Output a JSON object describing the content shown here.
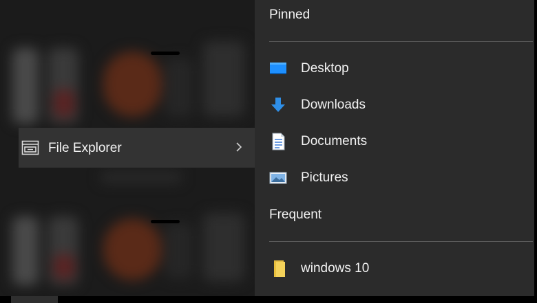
{
  "start_menu": {
    "app_item": {
      "label": "File Explorer",
      "icon": "file-explorer-icon",
      "chevron": "chevron-right-icon"
    }
  },
  "jump_list": {
    "pinned_header": "Pinned",
    "pinned_items": [
      {
        "label": "Desktop",
        "icon": "desktop-folder-icon"
      },
      {
        "label": "Downloads",
        "icon": "downloads-arrow-icon"
      },
      {
        "label": "Documents",
        "icon": "documents-icon"
      },
      {
        "label": "Pictures",
        "icon": "pictures-icon"
      }
    ],
    "frequent_header": "Frequent",
    "frequent_items": [
      {
        "label": "windows 10",
        "icon": "folder-icon"
      }
    ]
  },
  "colors": {
    "flyout_bg": "#2b2b2b",
    "selected_row_bg": "#333333",
    "text": "#f2f2f2",
    "divider": "#5a5a5a",
    "desktop_blue": "#1e90ff",
    "downloads_blue": "#2f8fe8",
    "folder_yellow": "#f4d25a"
  }
}
